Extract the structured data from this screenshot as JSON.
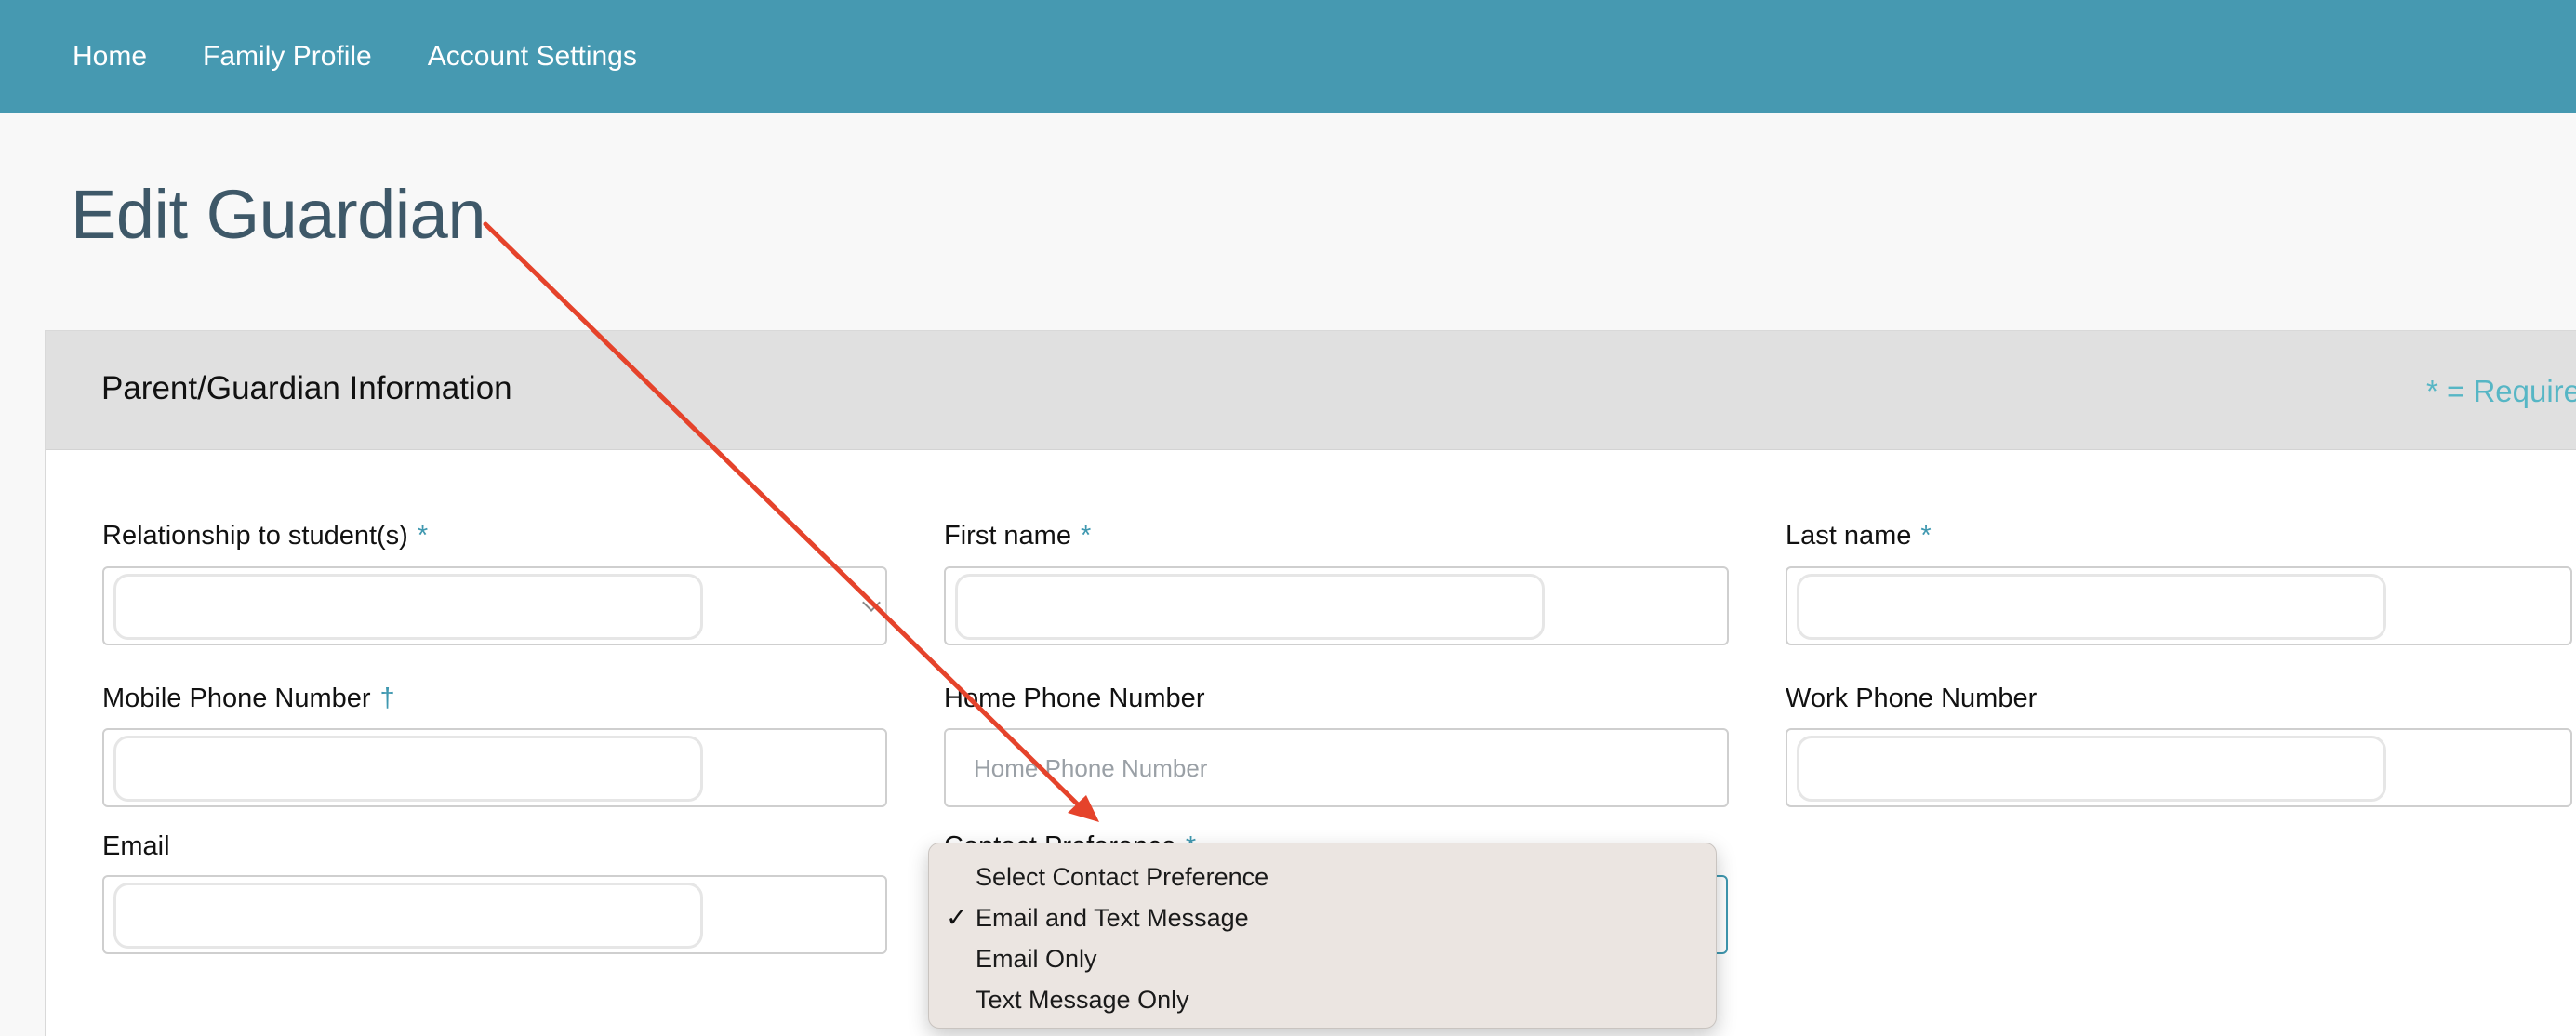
{
  "nav": {
    "items": [
      {
        "label": "Home"
      },
      {
        "label": "Family Profile"
      },
      {
        "label": "Account Settings"
      }
    ]
  },
  "page": {
    "title": "Edit Guardian"
  },
  "panel": {
    "title": "Parent/Guardian Information",
    "required_note": "* = Required"
  },
  "fields": {
    "relationship": {
      "label": "Relationship to student(s)",
      "mark": "*"
    },
    "first_name": {
      "label": "First name",
      "mark": "*"
    },
    "last_name": {
      "label": "Last name",
      "mark": "*"
    },
    "mobile_phone": {
      "label": "Mobile Phone Number",
      "mark": "†"
    },
    "home_phone": {
      "label": "Home Phone Number",
      "placeholder": "Home Phone Number"
    },
    "work_phone": {
      "label": "Work Phone Number"
    },
    "email": {
      "label": "Email"
    },
    "contact_pref": {
      "label": "Contact Preference",
      "mark": "*"
    }
  },
  "dropdown": {
    "options": [
      {
        "label": "Select Contact Preference",
        "check": ""
      },
      {
        "label": "Email and Text Message",
        "check": "✓"
      },
      {
        "label": "Email Only",
        "check": ""
      },
      {
        "label": "Text Message Only",
        "check": ""
      }
    ],
    "selected": "Email and Text Message"
  },
  "colors": {
    "navbar": "#4699b1",
    "accent": "#3f98b0",
    "annotation_arrow": "#e5432b"
  },
  "icons": [
    "chevron-down-icon",
    "checkmark-icon",
    "annotation-arrow"
  ]
}
